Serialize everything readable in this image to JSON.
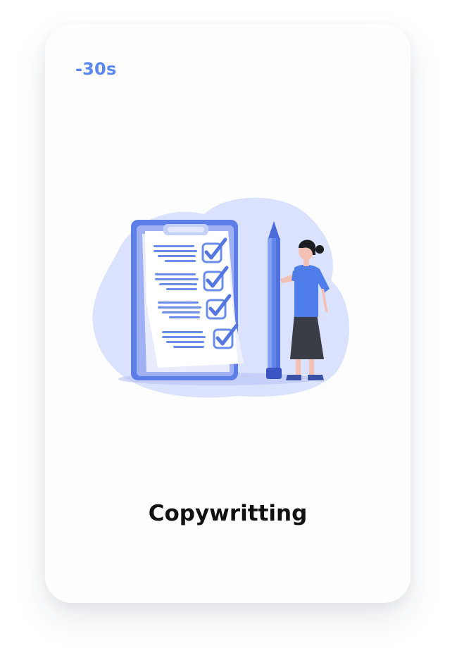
{
  "card": {
    "discount_label": "-30s",
    "title": "Copywritting"
  },
  "icons": {
    "illustration": "copywriting-checklist-illustration"
  },
  "colors": {
    "accent": "#5a88ef",
    "title": "#111111",
    "blob": "#dbe2fd",
    "clipboard": "#5c7ee6"
  }
}
